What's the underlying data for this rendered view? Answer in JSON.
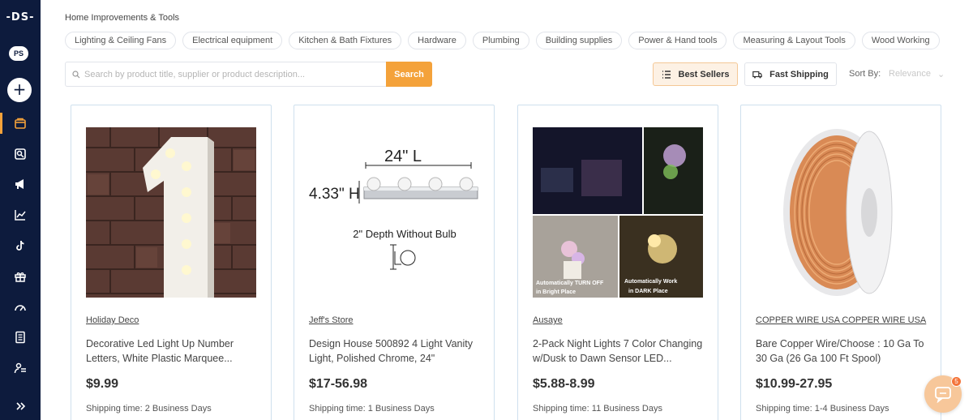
{
  "sidebar": {
    "logo": "-DS-",
    "store_badge": "PS",
    "add_label": "+",
    "items": [
      {
        "icon": "store-icon",
        "active": true
      },
      {
        "icon": "catalog-icon",
        "active": false
      },
      {
        "icon": "megaphone-icon",
        "active": false
      },
      {
        "icon": "analytics-icon",
        "active": false
      },
      {
        "icon": "tiktok-icon",
        "active": false
      },
      {
        "icon": "gift-box-icon",
        "active": false
      },
      {
        "icon": "speedometer-icon",
        "active": false
      },
      {
        "icon": "document-icon",
        "active": false
      },
      {
        "icon": "team-icon",
        "active": false
      }
    ],
    "expand_icon": "double-chevron-right-icon"
  },
  "breadcrumb": "Home Improvements & Tools",
  "categories": [
    "Lighting & Ceiling Fans",
    "Electrical equipment",
    "Kitchen & Bath Fixtures",
    "Hardware",
    "Plumbing",
    "Building supplies",
    "Power & Hand tools",
    "Measuring & Layout Tools",
    "Wood Working"
  ],
  "search": {
    "placeholder": "Search by product title, supplier or product description...",
    "button_label": "Search"
  },
  "filters": {
    "best_sellers": "Best Sellers",
    "fast_shipping": "Fast Shipping",
    "sort_label": "Sort By:",
    "sort_value": "Relevance"
  },
  "products": [
    {
      "supplier": "Holiday Deco",
      "title": "Decorative Led Light Up Number Letters, White Plastic Marquee...",
      "price": "$9.99",
      "shipping": "Shipping time: 2 Business Days"
    },
    {
      "supplier": "Jeff's Store",
      "title": "Design House 500892 4 Light Vanity Light, Polished Chrome, 24\"",
      "price": "$17-56.98",
      "shipping": "Shipping time: 1 Business Days",
      "image_text": {
        "width": "24\" L",
        "height": "4.33\" H",
        "depth": "2\" Depth Without Bulb"
      }
    },
    {
      "supplier": "Ausaye",
      "title": "2-Pack Night Lights 7 Color Changing w/Dusk to Dawn Sensor LED...",
      "price": "$5.88-8.99",
      "shipping": "Shipping time: 11 Business Days",
      "image_text": {
        "left_caption_1": "Automatically TURN OFF",
        "left_caption_2": "in Bright Place",
        "right_caption_1": "Automatically Work",
        "right_caption_2": "in DARK Place"
      }
    },
    {
      "supplier": "COPPER WIRE USA COPPER WIRE USA",
      "title": "Bare Copper Wire/Choose : 10 Ga To 30 Ga (26 Ga 100 Ft Spool)",
      "price": "$10.99-27.95",
      "shipping": "Shipping time: 1-4 Business Days"
    }
  ],
  "chat": {
    "badge_count": "5"
  },
  "colors": {
    "sidebar_bg": "#0d1b3d",
    "accent": "#f4a23a",
    "card_border": "#cfe0ee"
  }
}
